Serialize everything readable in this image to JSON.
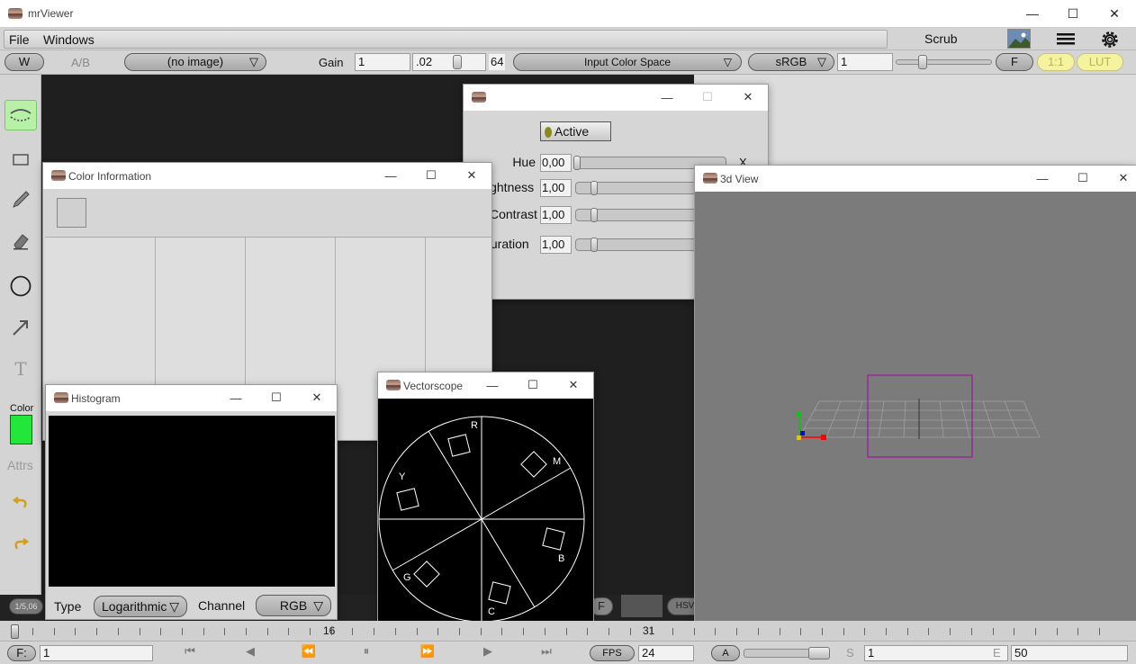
{
  "app": {
    "title": "mrViewer"
  },
  "menu": {
    "file": "File",
    "windows": "Windows",
    "scrub": "Scrub"
  },
  "toolbar": {
    "w_label": "W",
    "ab_label": "A/B",
    "image_select": "(no image)",
    "gain_label": "Gain",
    "gain_value": "1",
    "gamma_value": ".02",
    "gamma_max": "64",
    "color_space": "Input Color Space",
    "display": "sRGB",
    "display_value": "1",
    "f_label": "F",
    "ratio_label": "1:1",
    "lut_label": "LUT"
  },
  "tools": {
    "text_glyph": "T",
    "color_label": "Color",
    "attrs_label": "Attrs",
    "color_swatch": "#22e63a"
  },
  "color_controls": {
    "active_label": "Active",
    "hue_label": "Hue",
    "hue_value": "0,00",
    "brightness_label": "ightness",
    "brightness_value": "1,00",
    "contrast_label": "Contrast",
    "contrast_value": "1,00",
    "saturation_label": "turation",
    "saturation_value": "1,00",
    "x_label": "X"
  },
  "color_info": {
    "title": "Color Information"
  },
  "histogram": {
    "title": "Histogram",
    "type_label": "Type",
    "type_value": "Logarithmic",
    "channel_label": "Channel",
    "channel_value": "RGB"
  },
  "vectorscope": {
    "title": "Vectorscope",
    "labels": {
      "r": "R",
      "m": "M",
      "y": "Y",
      "b": "B",
      "g": "G",
      "c": "C"
    }
  },
  "view3d": {
    "title": "3d View"
  },
  "viewer_hud": {
    "hsv_label": "HSV",
    "f_partial": "F",
    "fps_small": "1/5,06"
  },
  "timeline": {
    "mark_16": "16",
    "mark_31": "31"
  },
  "bottom": {
    "frame_label": "F:",
    "frame_value": "1",
    "fps_label": "FPS",
    "fps_value": "24",
    "a_label": "A",
    "s_label": "S",
    "start_value": "1",
    "e_label": "E",
    "end_value": "50"
  },
  "colors": {
    "accent_yellow": "#f5f3a0",
    "active_green": "#b8f0a8",
    "axis_red": "#ff0000",
    "axis_green": "#00cc00",
    "axis_blue": "#0000ff",
    "box_purple": "#9a1a9a"
  }
}
